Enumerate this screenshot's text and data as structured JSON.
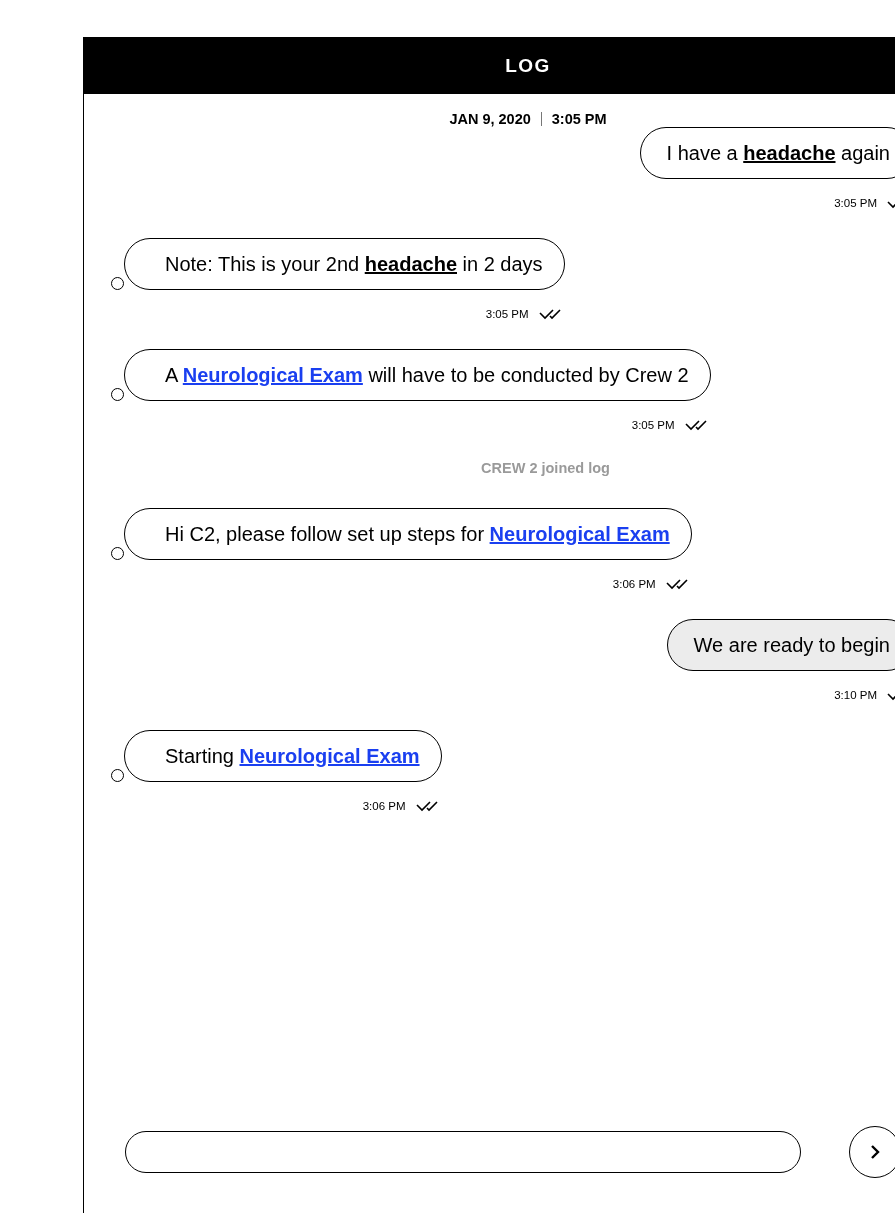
{
  "header": {
    "title": "LOG"
  },
  "date_line": {
    "date": "JAN 9, 2020",
    "time": "3:05 PM"
  },
  "messages": [
    {
      "kind": "outgoing",
      "highlighted": false,
      "time": "3:05 PM",
      "parts": [
        {
          "kind": "plain",
          "text": "I have a "
        },
        {
          "kind": "term",
          "text": "headache"
        },
        {
          "kind": "plain",
          "text": " again"
        }
      ]
    },
    {
      "kind": "incoming",
      "highlighted": false,
      "time": "3:05 PM",
      "parts": [
        {
          "kind": "plain",
          "text": "Note: This is your 2nd "
        },
        {
          "kind": "term",
          "text": "headache"
        },
        {
          "kind": "plain",
          "text": " in 2 days"
        }
      ]
    },
    {
      "kind": "incoming",
      "highlighted": false,
      "time": "3:05 PM",
      "parts": [
        {
          "kind": "plain",
          "text": "A "
        },
        {
          "kind": "link",
          "text": "Neurological Exam"
        },
        {
          "kind": "plain",
          "text": " will have to be conducted by Crew 2"
        }
      ]
    },
    {
      "kind": "event",
      "text": "CREW 2 joined log"
    },
    {
      "kind": "incoming",
      "highlighted": false,
      "time": "3:06 PM",
      "parts": [
        {
          "kind": "plain",
          "text": "Hi C2, please follow set up steps for "
        },
        {
          "kind": "link",
          "text": "Neurological Exam"
        }
      ]
    },
    {
      "kind": "outgoing",
      "highlighted": true,
      "time": "3:10 PM",
      "parts": [
        {
          "kind": "plain",
          "text": "We are ready to begin"
        }
      ]
    },
    {
      "kind": "incoming",
      "highlighted": false,
      "time": "3:06 PM",
      "parts": [
        {
          "kind": "plain",
          "text": "Starting "
        },
        {
          "kind": "link",
          "text": "Neurological Exam"
        }
      ]
    }
  ]
}
